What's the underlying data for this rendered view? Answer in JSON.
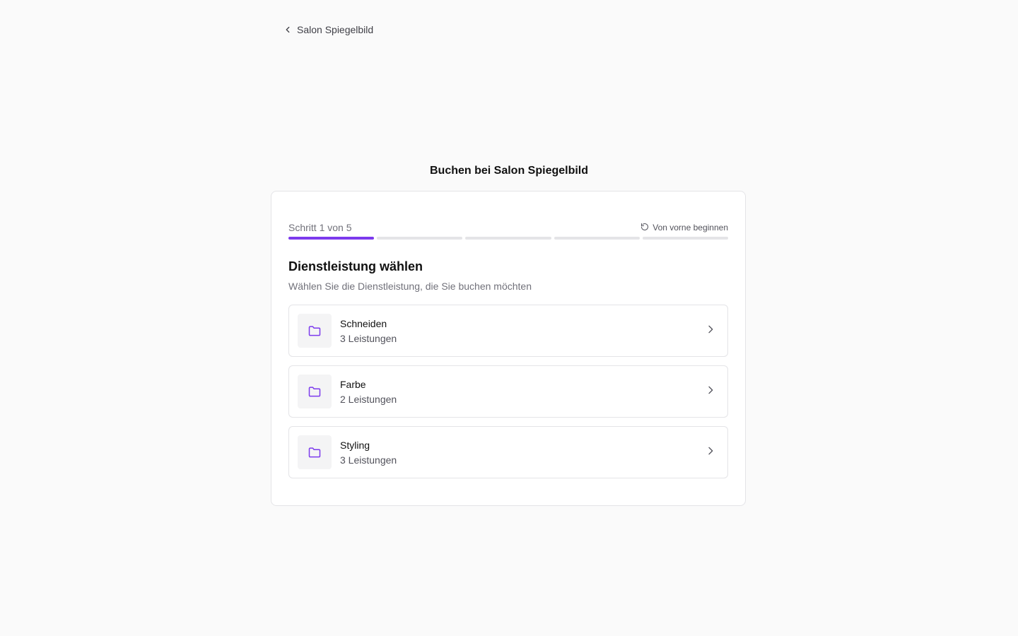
{
  "header": {
    "back_label": "Salon Spiegelbild"
  },
  "page": {
    "title": "Buchen bei Salon Spiegelbild"
  },
  "wizard": {
    "step_label": "Schritt 1 von 5",
    "current_step": 1,
    "total_steps": 5,
    "restart_label": "Von vorne beginnen",
    "section_title": "Dienstleistung wählen",
    "section_subtitle": "Wählen Sie die Dienstleistung, die Sie buchen möchten",
    "categories": [
      {
        "name": "Schneiden",
        "count": "3 Leistungen"
      },
      {
        "name": "Farbe",
        "count": "2 Leistungen"
      },
      {
        "name": "Styling",
        "count": "3 Leistungen"
      }
    ]
  },
  "icons": {
    "back": "chevron-left-icon",
    "restart": "rotate-ccw-icon",
    "category": "folder-icon",
    "item_arrow": "chevron-right-icon"
  },
  "colors": {
    "accent": "#7c3aed",
    "background": "#fafafa",
    "border": "#e4e4e7",
    "inactive_segment": "#e4e4e7"
  }
}
